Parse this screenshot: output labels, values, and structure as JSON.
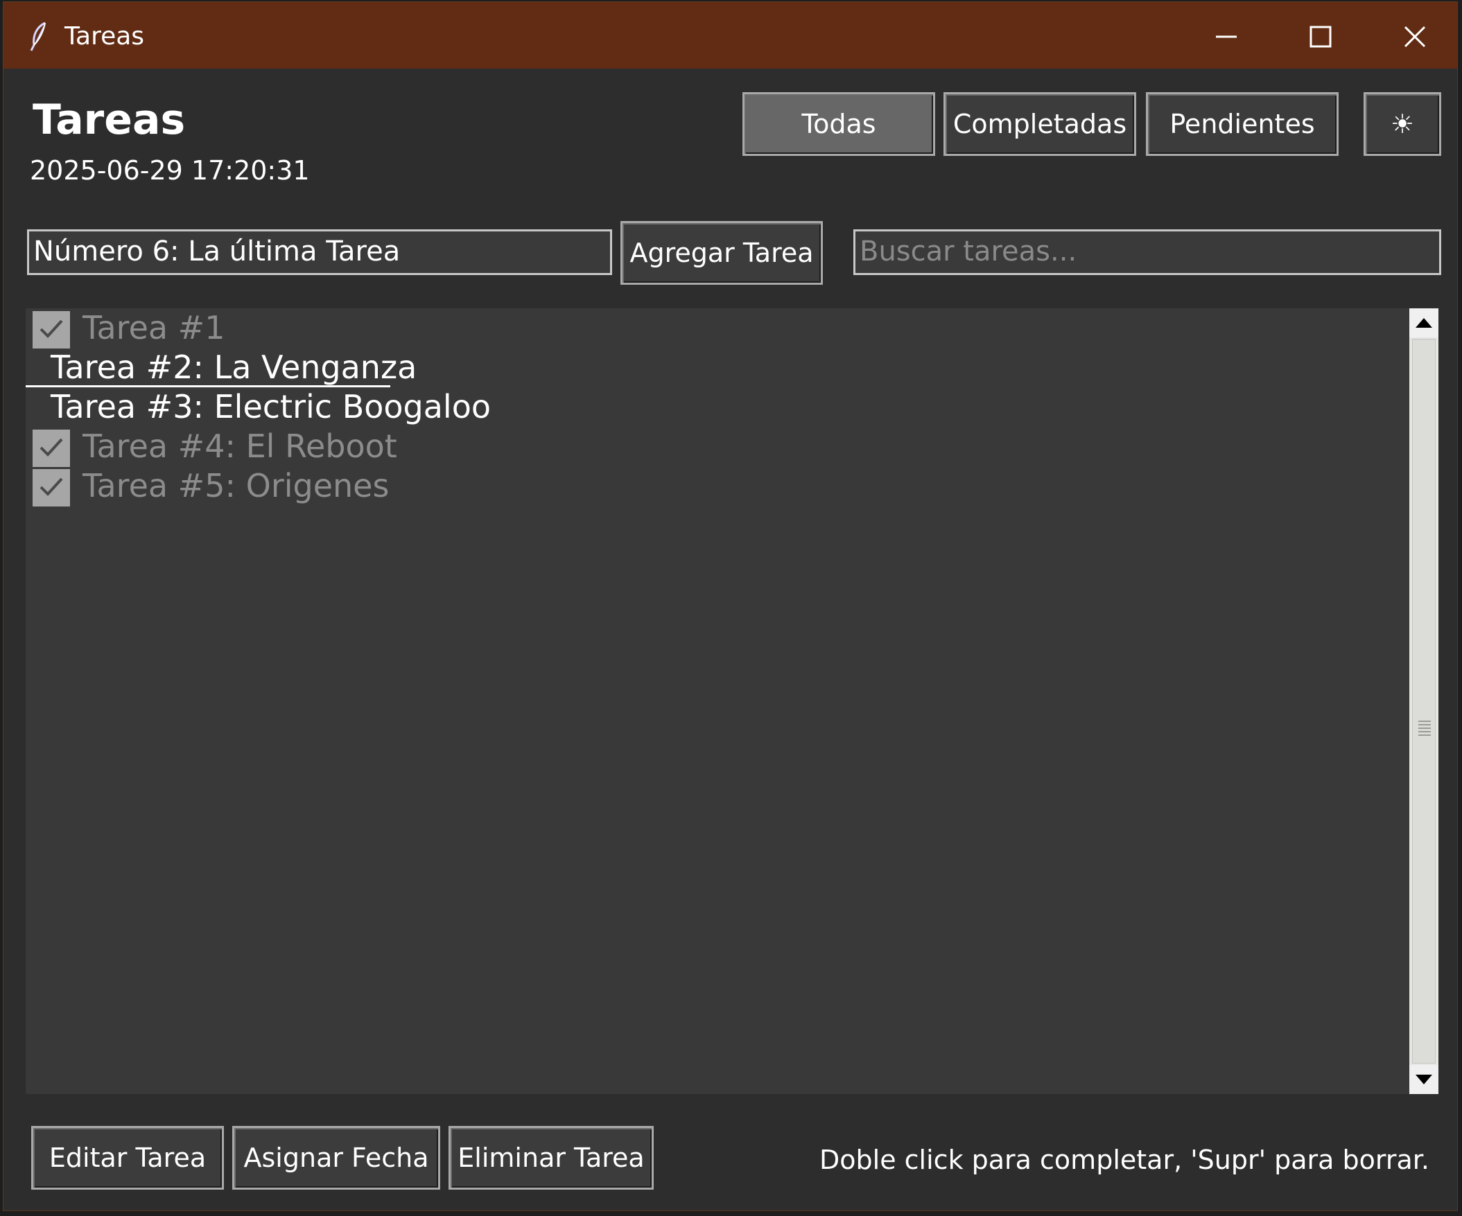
{
  "window": {
    "title": "Tareas",
    "icon": "feather-icon",
    "minimize_icon": "minimize-icon",
    "maximize_icon": "maximize-icon",
    "close_icon": "close-icon",
    "titlebar_color": "#622c14"
  },
  "header": {
    "title": "Tareas",
    "clock": "2025-06-29 17:20:31"
  },
  "filters": {
    "all": "Todas",
    "completed": "Completadas",
    "pending": "Pendientes",
    "active": "Todas",
    "theme_toggle": "☀"
  },
  "add": {
    "input_value": "Número 6: La última Tarea",
    "button": "Agregar Tarea"
  },
  "search": {
    "placeholder": "Buscar tareas..."
  },
  "tasks": [
    {
      "label": "Tarea #1",
      "done": true
    },
    {
      "label": "Tarea #2: La Venganza",
      "done": false,
      "selected": true
    },
    {
      "label": "Tarea #3: Electric Boogaloo",
      "done": false
    },
    {
      "label": "Tarea #4: El Reboot",
      "done": true
    },
    {
      "label": "Tarea #5: Origenes",
      "done": true
    }
  ],
  "actions": {
    "edit": "Editar Tarea",
    "date": "Asignar Fecha",
    "delete": "Eliminar Tarea"
  },
  "hint": "Doble click para completar, 'Supr' para borrar."
}
